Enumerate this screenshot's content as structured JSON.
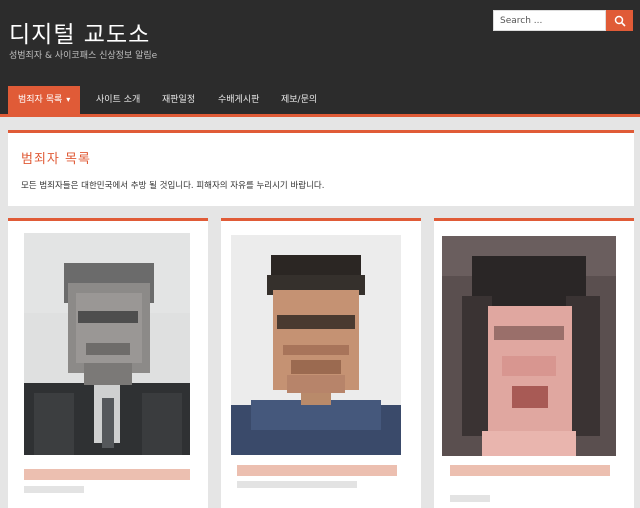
{
  "site": {
    "title": "디지털 교도소",
    "tagline": "성범죄자 & 사이코패스 신상정보 알림e"
  },
  "search": {
    "placeholder": "Search ..."
  },
  "nav": {
    "items": [
      {
        "label": "범죄자 목록",
        "active": true,
        "has_dropdown": true
      },
      {
        "label": "사이트 소개",
        "active": false
      },
      {
        "label": "재판일정",
        "active": false
      },
      {
        "label": "수배게시판",
        "active": false
      },
      {
        "label": "제보/문의",
        "active": false
      }
    ]
  },
  "intro": {
    "title": "범죄자 목록",
    "text": "모든 범죄자들은 대한민국에서 추방 될 것입니다. 피해자의 자유를 누리시기 바랍니다."
  },
  "cards": [
    {
      "photo": "pixelated portrait (censored)"
    },
    {
      "photo": "pixelated portrait (censored)"
    },
    {
      "photo": "pixelated portrait (censored)"
    }
  ],
  "colors": {
    "accent": "#e05b37",
    "header_bg": "#2c2c2c",
    "page_bg": "#e5e5e5"
  }
}
